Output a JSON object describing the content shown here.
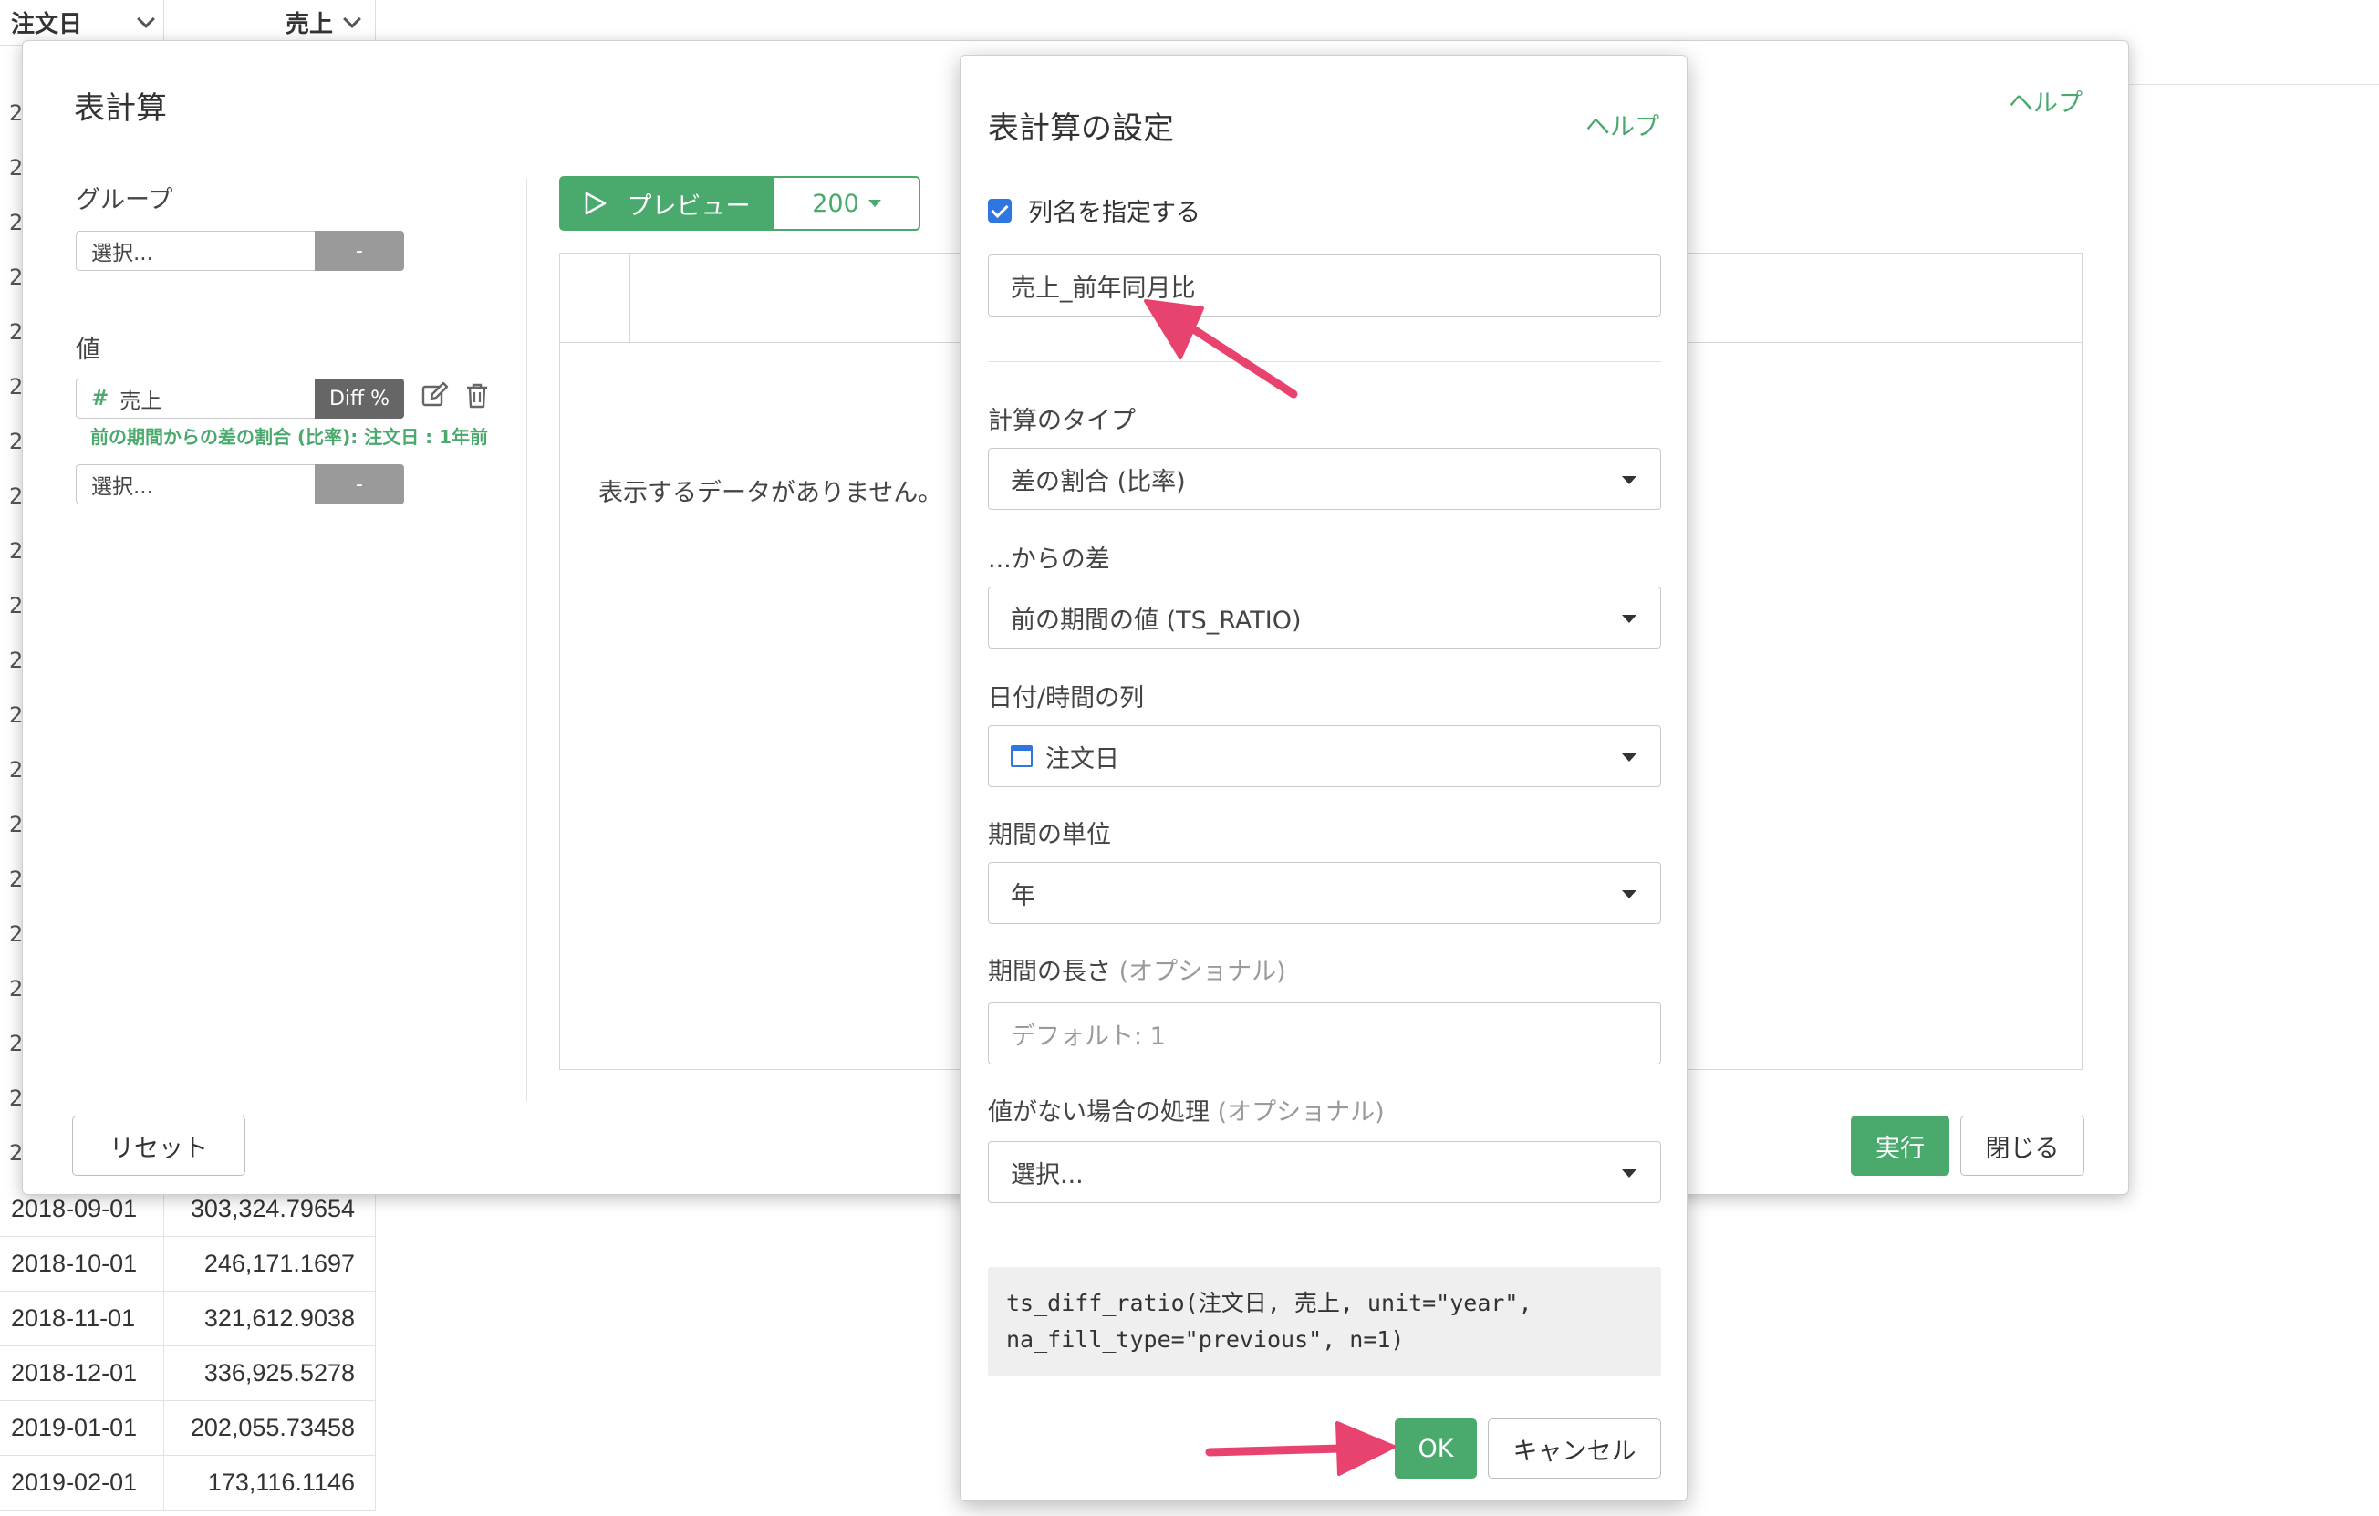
{
  "bg_table": {
    "col_date": "注文日",
    "col_sales": "売上",
    "gutter_char": "2",
    "rows": [
      {
        "date": "2018-09-01",
        "value": "303,324.79654"
      },
      {
        "date": "2018-10-01",
        "value": "246,171.1697"
      },
      {
        "date": "2018-11-01",
        "value": "321,612.9038"
      },
      {
        "date": "2018-12-01",
        "value": "336,925.5278"
      },
      {
        "date": "2019-01-01",
        "value": "202,055.73458"
      },
      {
        "date": "2019-02-01",
        "value": "173,116.1146"
      }
    ]
  },
  "main_modal": {
    "title": "表計算",
    "help": "ヘルプ",
    "group_label": "グループ",
    "group_select": "選択...",
    "value_label": "値",
    "value_field": "売上",
    "value_tag": "Diff %",
    "value_note": "前の期間からの差の割合 (比率): 注文日 : 1年前",
    "value_select": "選択...",
    "dash": "-",
    "preview_label": "プレビュー",
    "preview_count": "200",
    "empty_msg": "表示するデータがありません。",
    "reset": "リセット",
    "run": "実行",
    "close": "閉じる"
  },
  "settings_modal": {
    "title": "表計算の設定",
    "help": "ヘルプ",
    "checkbox_label": "列名を指定する",
    "column_name": "売上_前年同月比",
    "calc_type_label": "計算のタイプ",
    "calc_type": "差の割合 (比率)",
    "diff_from_label": "...からの差",
    "diff_from": "前の期間の値 (TS_RATIO)",
    "date_col_label": "日付/時間の列",
    "date_col": "注文日",
    "unit_label": "期間の単位",
    "unit": "年",
    "length_label": "期間の長さ",
    "length_opt": "(オプショナル)",
    "length_placeholder": "デフォルト: 1",
    "na_label": "値がない場合の処理",
    "na_opt": "(オプショナル)",
    "na_select": "選択...",
    "code_line1": "ts_diff_ratio(注文日, 売上, unit=\"year\",",
    "code_line2": "na_fill_type=\"previous\", n=1)",
    "ok": "OK",
    "cancel": "キャンセル"
  },
  "colors": {
    "accent_green": "#4aa96c",
    "annotation_arrow": "#e8436e",
    "checkbox_blue": "#2f76e0"
  }
}
